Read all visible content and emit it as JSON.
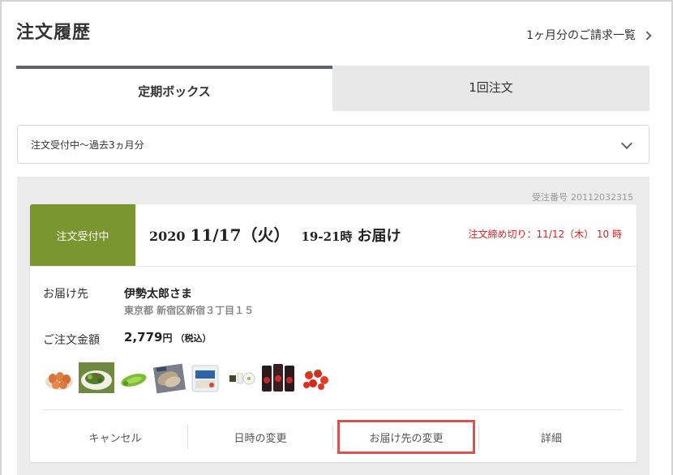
{
  "header": {
    "title": "注文履歴",
    "invoice_link": "1ヶ月分のご請求一覧"
  },
  "tabs": [
    {
      "label": "定期ボックス",
      "active": true
    },
    {
      "label": "1回注文",
      "active": false
    }
  ],
  "filter": {
    "selected": "注文受付中〜過去3ヵ月分"
  },
  "order": {
    "number_label": "受注番号",
    "number": "20112032315",
    "status": "注文受付中",
    "delivery": {
      "year": "2020",
      "date": "11/17（火）",
      "time": "19-21時",
      "suffix": "お届け"
    },
    "deadline": "注文締め切り：11/12（木） 10 時",
    "destination_label": "お届け先",
    "destination_name": "伊勢太郎さま",
    "destination_address": "東京都 新宿区新宿３丁目１５",
    "amount_label": "ご注文金額",
    "amount_value": "2,779",
    "amount_unit": "円",
    "amount_tax": "（税込）",
    "product_icons": [
      "eggs-thumbnail",
      "salad-thumbnail",
      "green-vegetable-thumbnail",
      "fish-thumbnail",
      "packaged-food-thumbnail",
      "condiment-thumbnail",
      "canned-goods-thumbnail",
      "cherry-tomatoes-thumbnail"
    ],
    "actions": {
      "cancel": "キャンセル",
      "change_datetime": "日時の変更",
      "change_destination": "お届け先の変更",
      "details": "詳細"
    }
  },
  "colors": {
    "status_green": "#7a962f",
    "deadline_red": "#e0201c",
    "highlight_red": "#d9534f",
    "tab_active_border": "#5c6368",
    "tab_inactive_bg": "#e8e8e8",
    "list_bg": "#ececec"
  }
}
